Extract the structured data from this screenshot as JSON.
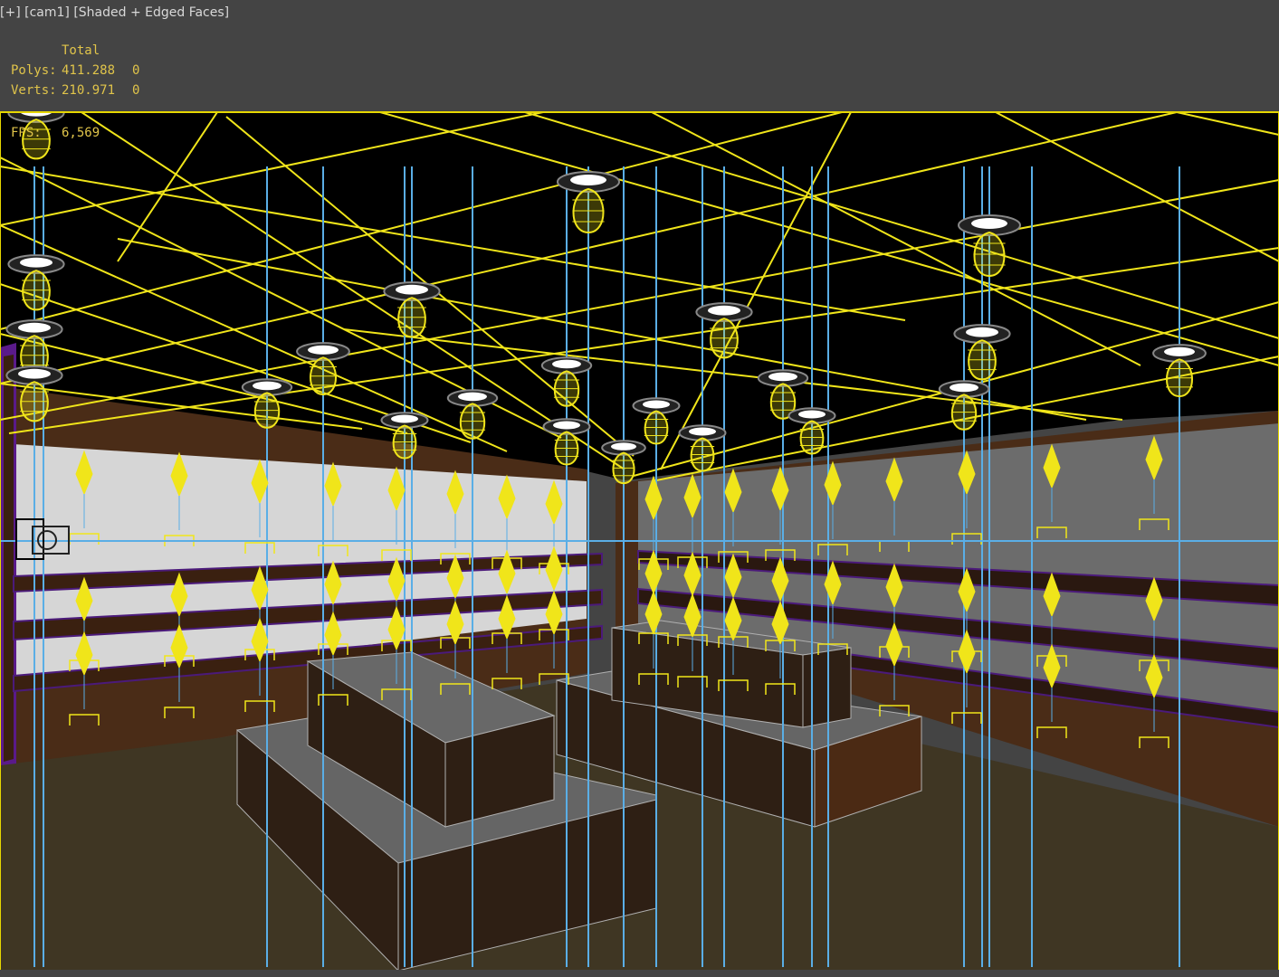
{
  "viewport": {
    "plus_label": "[+]",
    "camera_label": "[cam1]",
    "shading_label": "[Shaded + Edged Faces]"
  },
  "stats": {
    "header": "Total",
    "polys_label": "Polys:",
    "polys_total": "411.288",
    "polys_selected": "0",
    "verts_label": "Verts:",
    "verts_total": "210.971",
    "verts_selected": "0",
    "fps_label": "FPS:",
    "fps_value": "6,569"
  },
  "colors": {
    "wireframe": "#f0e51a",
    "helper_line": "#5aaee6",
    "ceiling": "#000000",
    "wall": "#4a2c17",
    "panel_left": "#d4d4d4",
    "panel_right": "#6b6b6b",
    "floor": "#3f3623",
    "shelf_edge": "#4b1a7a"
  },
  "icons": {
    "ceiling_light": "ceiling-light-icon",
    "photometric_light": "photometric-light-icon",
    "camera": "camera-icon"
  }
}
